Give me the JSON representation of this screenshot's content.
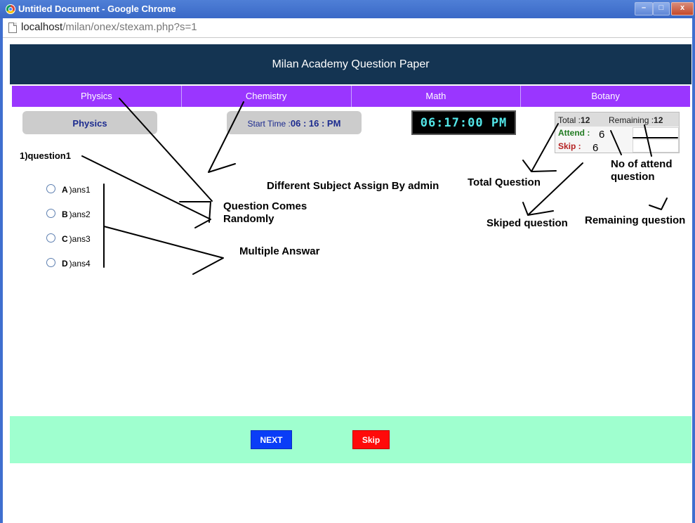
{
  "browser": {
    "window_title": "Untitled Document - Google Chrome",
    "url_host": "localhost",
    "url_path": "/milan/onex/stexam.php?s=1",
    "controls": {
      "minimize": "–",
      "maximize": "□",
      "close": "x"
    }
  },
  "header": {
    "title": "Milan Academy Question Paper"
  },
  "tabs": [
    {
      "label": "Physics"
    },
    {
      "label": "Chemistry"
    },
    {
      "label": "Math"
    },
    {
      "label": "Botany"
    }
  ],
  "current_subject": "Physics",
  "start_time": {
    "label": "Start Time :",
    "value": "06 : 16 : PM"
  },
  "clock": "06:17:00 PM",
  "stats": {
    "total_label": "Total  :",
    "total_value": "12",
    "remaining_label": "Remaining :",
    "remaining_value": "12",
    "attend_label": "Attend :",
    "attend_value": "6",
    "skip_label": "Skip :",
    "skip_value": "6"
  },
  "question": {
    "text": "1)question1",
    "options": [
      {
        "letter": "A",
        "text": ")ans1"
      },
      {
        "letter": "B",
        "text": ")ans2"
      },
      {
        "letter": "C",
        "text": ")ans3"
      },
      {
        "letter": "D",
        "text": ")ans4"
      }
    ]
  },
  "annotations": {
    "subject_assign": "Different Subject Assign By admin",
    "random_line1": "Question Comes",
    "random_line2": "Randomly",
    "multiple": "Multiple Answar",
    "total_question": "Total Question",
    "attend_line1": "No of attend",
    "attend_line2": "question",
    "skiped": "Skiped question",
    "remaining": "Remaining question"
  },
  "buttons": {
    "next": "NEXT",
    "skip": "Skip"
  },
  "colors": {
    "header_bg": "#143452",
    "tab_bg": "#9a36ff",
    "footer_bg": "#9fffcf",
    "next_bg": "#0a3df7",
    "skip_bg": "#ff0a0a",
    "clock_text": "#53e6e8"
  }
}
